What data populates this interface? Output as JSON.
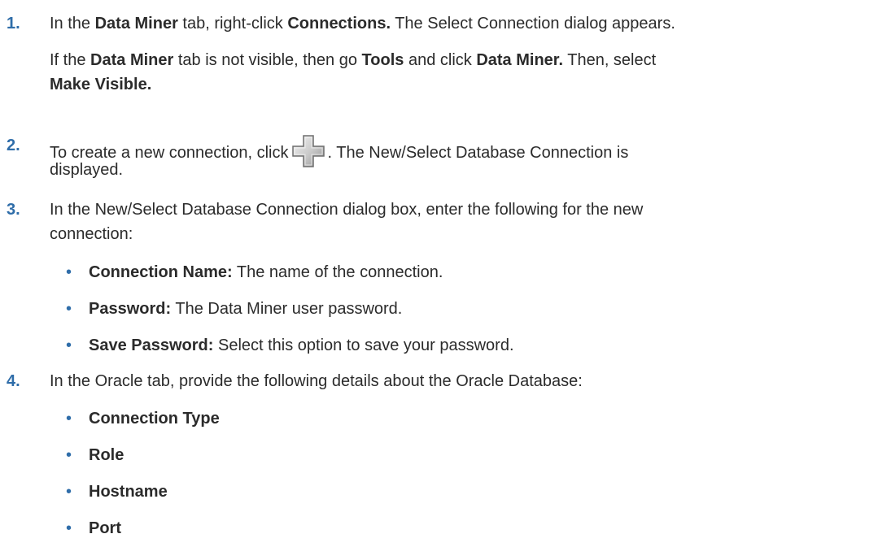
{
  "steps": [
    {
      "number": "1.",
      "line1": {
        "pre": "In the ",
        "b1": "Data Miner",
        "mid1": " tab, right-click ",
        "b2": "Connections.",
        "post": " The Select Connection dialog appears."
      },
      "note": {
        "pre": "If the ",
        "b1": "Data Miner",
        "mid1": " tab is not visible, then go ",
        "b2": "Tools",
        "mid2": " and click ",
        "b3": "Data Miner.",
        "mid3": " Then, select",
        "b4": "Make Visible."
      }
    },
    {
      "number": "2.",
      "pre": "To create a new connection, click",
      "post": ". The New/Select Database Connection is",
      "cont": "displayed.",
      "icon": "plus-icon"
    },
    {
      "number": "3.",
      "line1": "In the New/Select Database Connection dialog box, enter the following for the new",
      "line2": "connection:",
      "bullets": [
        {
          "label": "Connection Name:",
          "text": " The name of the connection."
        },
        {
          "label": "Password:",
          "text": " The Data Miner user password."
        },
        {
          "label": "Save Password:",
          "text": " Select this option to save your password."
        }
      ]
    },
    {
      "number": "4.",
      "line1": "In the Oracle tab, provide the following details about the Oracle Database:",
      "bullets": [
        {
          "label": "Connection Type"
        },
        {
          "label": "Role"
        },
        {
          "label": "Hostname"
        },
        {
          "label": "Port"
        }
      ]
    }
  ],
  "bullet_char": "•",
  "colors": {
    "text": "#2b2b2b",
    "accent": "#2f6da9"
  }
}
